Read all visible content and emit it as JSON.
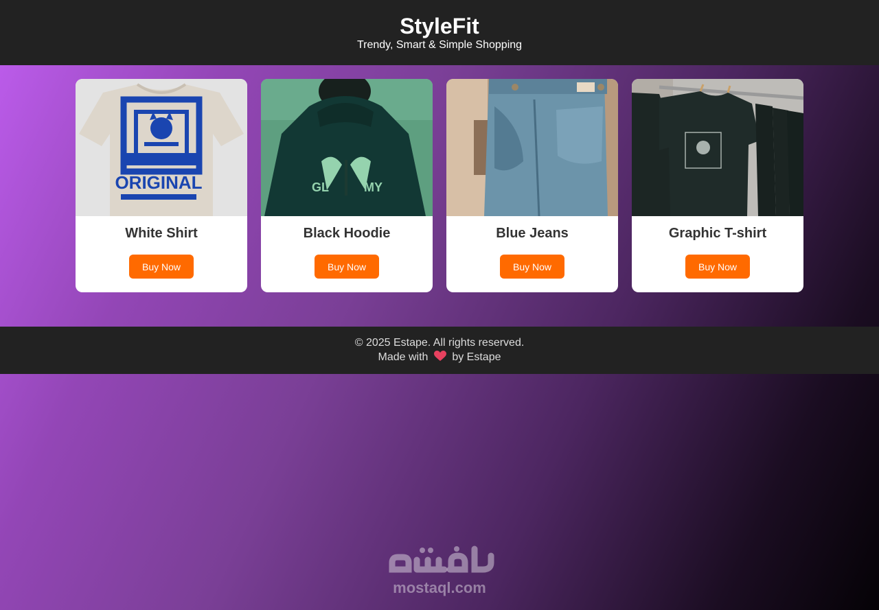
{
  "header": {
    "title": "StyleFit",
    "tagline": "Trendy, Smart & Simple Shopping"
  },
  "products": [
    {
      "name": "White Shirt",
      "button_label": "Buy Now",
      "image_icon": "white-shirt-photo"
    },
    {
      "name": "Black Hoodie",
      "button_label": "Buy Now",
      "image_icon": "black-hoodie-photo"
    },
    {
      "name": "Blue Jeans",
      "button_label": "Buy Now",
      "image_icon": "blue-jeans-photo"
    },
    {
      "name": "Graphic T-shirt",
      "button_label": "Buy Now",
      "image_icon": "graphic-tshirt-photo"
    }
  ],
  "footer": {
    "copyright": "© 2025 Estape. All rights reserved.",
    "made_with": "Made with",
    "by": "by Estape",
    "heart_icon": "heart-icon"
  },
  "watermark": {
    "text": "mostaql.com"
  },
  "colors": {
    "header_bg": "#222222",
    "button_bg": "#ff6a00",
    "gradient_start": "#c05ef0",
    "gradient_end": "#050206"
  }
}
